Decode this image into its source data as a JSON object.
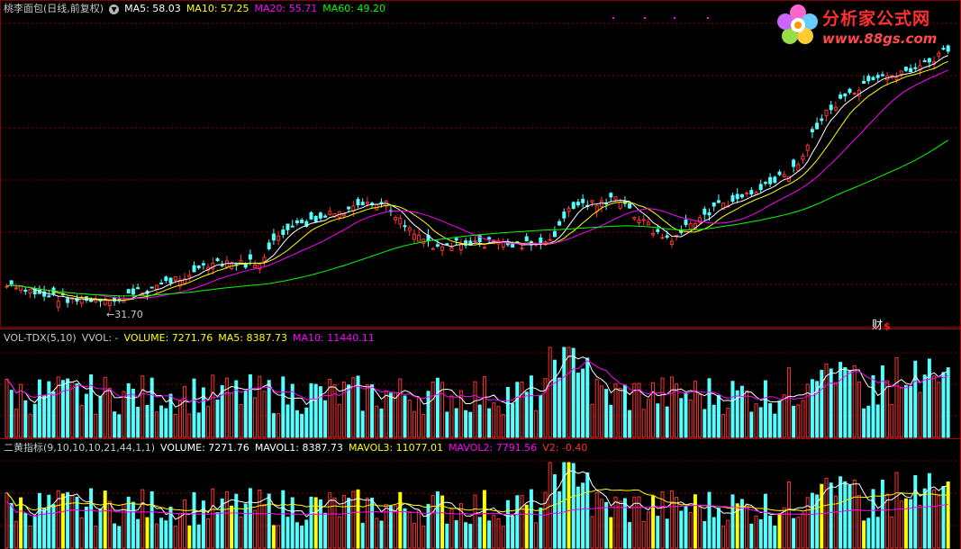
{
  "main": {
    "title": "桃李面包(日线,前复权)",
    "ma": [
      {
        "label": "MA5: 58.03",
        "color": "#ffffff"
      },
      {
        "label": "MA10: 57.25",
        "color": "#ffff00"
      },
      {
        "label": "MA20: 55.71",
        "color": "#ff00ff"
      },
      {
        "label": "MA60: 49.20",
        "color": "#00ff00"
      }
    ],
    "low_label": "31.70",
    "cai_label": "财",
    "cai_sub": "$"
  },
  "volume": {
    "title": "VOL-TDX(5,10)",
    "items": [
      {
        "label": "VVOL: -",
        "color": "#c8c8c8"
      },
      {
        "label": "VOLUME: 7271.76",
        "color": "#ffff00"
      },
      {
        "label": "MA5: 8387.73",
        "color": "#ffff00"
      },
      {
        "label": "MA10: 11440.11",
        "color": "#ff00ff"
      }
    ]
  },
  "erhuang": {
    "title": "二黄指标(9,10,10,10,21,44,1,1)",
    "items": [
      {
        "label": "VOLUME: 7271.76",
        "color": "#ffffff"
      },
      {
        "label": "MAVOL1: 8387.73",
        "color": "#ffffff"
      },
      {
        "label": "MAVOL3: 11077.01",
        "color": "#ffff00"
      },
      {
        "label": "MAVOL2: 7791.56",
        "color": "#ff00ff"
      },
      {
        "label": "V2: -0.40",
        "color": "#ff3030"
      }
    ]
  },
  "logo": {
    "name": "分析家公式网",
    "url": "www.88gs.com"
  },
  "colors": {
    "up": "#ff3232",
    "down": "#54ffff",
    "grid": "#8b0000",
    "ma5": "#ffffff",
    "ma10": "#ffff00",
    "ma20": "#ff00ff",
    "ma60": "#00ff00",
    "bg": "#000000"
  },
  "chart_data": {
    "type": "candlestick",
    "price_min_label": 31.7
  }
}
